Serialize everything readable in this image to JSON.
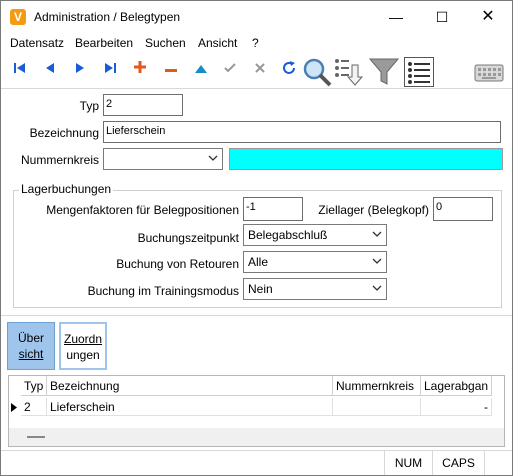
{
  "window": {
    "icon_letter": "V",
    "title": "Administration / Belegtypen",
    "minimize_glyph": "—",
    "maximize_glyph": "☐",
    "close_glyph": "✕"
  },
  "menu": [
    "Datensatz",
    "Bearbeiten",
    "Suchen",
    "Ansicht",
    "?"
  ],
  "toolbar": {
    "icons": [
      "first-record-icon",
      "prev-record-icon",
      "next-record-icon",
      "last-record-icon",
      "add-record-icon",
      "delete-record-icon",
      "up-icon",
      "confirm-icon",
      "cancel-icon",
      "refresh-icon",
      "search-icon",
      "filter-list-icon",
      "filter-icon",
      "list-view-icon",
      "keyboard-icon"
    ]
  },
  "form": {
    "typ_label": "Typ",
    "typ_value": "2",
    "bezeichnung_label": "Bezeichnung",
    "bezeichnung_value": "Lieferschein",
    "nummernkreis_label": "Nummernkreis",
    "nummernkreis_value": "",
    "nummernkreis_color": "#00ffff"
  },
  "lager": {
    "group_title": "Lagerbuchungen",
    "mengenfaktoren_label": "Mengenfaktoren für Belegpositionen",
    "mengenfaktoren_value": "-1",
    "ziellager_label": "Ziellager (Belegkopf)",
    "ziellager_value": "0",
    "buchungszeitpunkt_label": "Buchungszeitpunkt",
    "buchungszeitpunkt_value": "Belegabschluß",
    "retouren_label": "Buchung von Retouren",
    "retouren_value": "Alle",
    "training_label": "Buchung im Trainingsmodus",
    "training_value": "Nein"
  },
  "tabs": {
    "uebersicht_line1": "Über",
    "uebersicht_line2": "sicht",
    "zuordnungen_line1": "Zuordn",
    "zuordnungen_line2": "ungen"
  },
  "grid": {
    "headers": [
      "Typ",
      "Bezeichnung",
      "Nummernkreis",
      "Lagerabgan"
    ],
    "rows": [
      [
        "2",
        "Lieferschein",
        "",
        "-"
      ]
    ]
  },
  "status": {
    "num": "NUM",
    "caps": "CAPS"
  }
}
